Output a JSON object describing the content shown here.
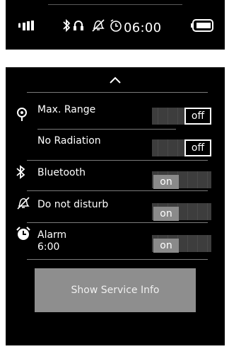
{
  "status": {
    "time": "06:00",
    "icons": [
      "signal-icon",
      "bluetooth-icon",
      "headset-icon",
      "do-not-disturb-icon",
      "alarm-clock-icon",
      "battery-icon"
    ]
  },
  "quick_settings": {
    "collapse_icon": "chevron-up-icon",
    "items": [
      {
        "label": "Max. Range",
        "icon": "range-icon",
        "state": "off"
      },
      {
        "label": "No Radiation",
        "icon": "",
        "state": "off"
      },
      {
        "label": "Bluetooth",
        "icon": "bluetooth-icon",
        "state": "on"
      },
      {
        "label": "Do not disturb",
        "icon": "do-not-disturb-icon",
        "state": "on"
      },
      {
        "label": "Alarm",
        "sublabel": "6:00",
        "icon": "alarm-clock-icon",
        "state": "on"
      }
    ],
    "service_button_label": "Show Service Info"
  }
}
